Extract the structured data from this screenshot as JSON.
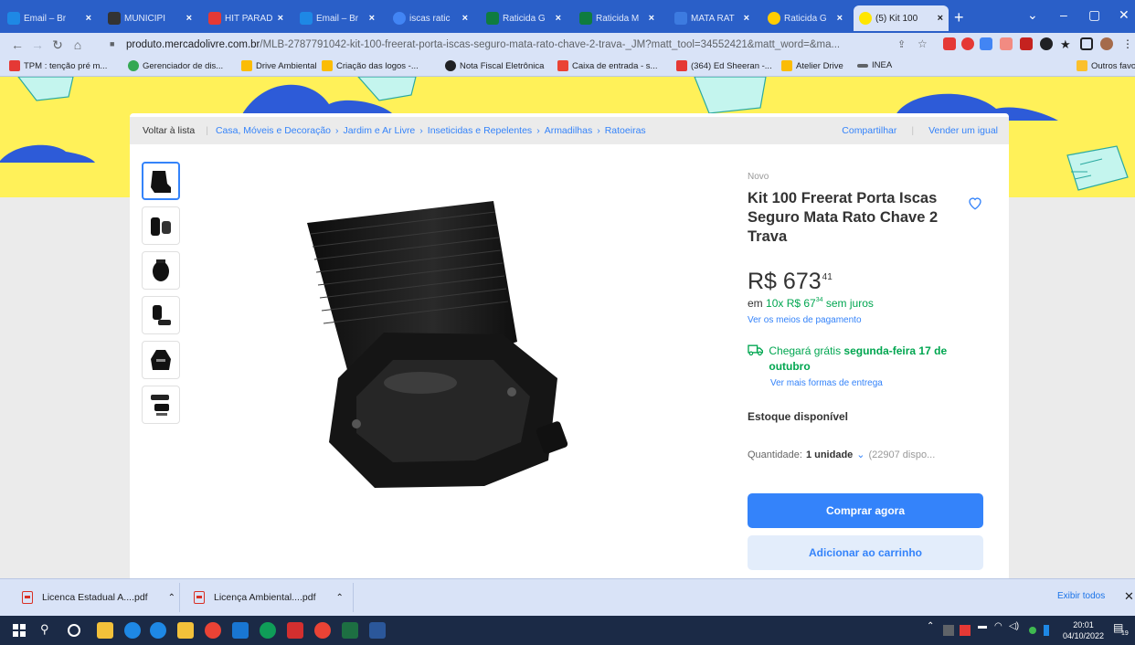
{
  "browser": {
    "tabs": [
      {
        "label": "Email – Br",
        "color": "#1e88e5"
      },
      {
        "label": "MUNICIPI",
        "color": "#333333"
      },
      {
        "label": "HIT PARAD",
        "color": "#e53935"
      },
      {
        "label": "Email – Br",
        "color": "#1e88e5"
      },
      {
        "label": "iscas ratic",
        "color": "#4285f4"
      },
      {
        "label": "Raticida G",
        "color": "#0f7c3f"
      },
      {
        "label": "Raticida M",
        "color": "#0f7c3f"
      },
      {
        "label": "MATA RAT",
        "color": "#3d7be0"
      },
      {
        "label": "Raticida G",
        "color": "#ffcc00"
      },
      {
        "label": "(5) Kit 100",
        "color": "#ffe600",
        "active": true
      }
    ],
    "url_host": "produto.mercadolivre.com.br",
    "url_path": "/MLB-2787791042-kit-100-freerat-porta-iscas-seguro-mata-rato-chave-2-trava-_JM?matt_tool=34552421&matt_word=&ma...",
    "bookmarks": [
      {
        "label": "TPM : tenção pré m...",
        "color": "#e53935"
      },
      {
        "label": "Gerenciador de dis...",
        "color": "#34a853"
      },
      {
        "label": "Drive Ambiental",
        "color": "#fbbc04"
      },
      {
        "label": "Criação das logos -...",
        "color": "#fbbc04"
      },
      {
        "label": "Nota Fiscal Eletrônica",
        "color": "#202124"
      },
      {
        "label": "Caixa de entrada - s...",
        "color": "#ea4335"
      },
      {
        "label": "(364) Ed Sheeran -...",
        "color": "#e53935"
      },
      {
        "label": "Atelier Drive",
        "color": "#fbbc04"
      },
      {
        "label": "INEA",
        "color": "#5f6368"
      }
    ],
    "other_bookmarks": "Outros favoritos"
  },
  "page": {
    "breadcrumb": {
      "back": "Voltar à lista",
      "items": [
        "Casa, Móveis e Decoração",
        "Jardim e Ar Livre",
        "Inseticidas e Repelentes",
        "Armadilhas",
        "Ratoeiras"
      ],
      "share": "Compartilhar",
      "sell": "Vender um igual"
    },
    "product": {
      "condition": "Novo",
      "title": "Kit 100 Freerat Porta Iscas Seguro Mata Rato Chave 2 Trava",
      "price_symbol": "R$",
      "price_int": "673",
      "price_cents": "41",
      "installments_prefix": "em ",
      "installments_count": "10x R$ 67",
      "installments_cents": "34",
      "installments_suffix": " sem juros",
      "payment_link": "Ver os meios de pagamento",
      "shipping_prefix": "Chegará grátis ",
      "shipping_date": "segunda-feira 17 de outubro",
      "shipping_more": "Ver mais formas de entrega",
      "stock": "Estoque disponível",
      "qty_label": "Quantidade: ",
      "qty_value": "1 unidade",
      "qty_available": "(22907 dispo...",
      "buy_now": "Comprar agora",
      "add_to_cart": "Adicionar ao carrinho"
    },
    "thumbnail_count": 6
  },
  "downloads": {
    "items": [
      "Licenca Estadual A....pdf",
      "Licença Ambiental....pdf"
    ],
    "show_all": "Exibir todos"
  },
  "taskbar": {
    "time": "20:01",
    "date": "04/10/2022",
    "notification_count": "19"
  },
  "colors": {
    "ml_yellow": "#fff159",
    "ml_blue": "#3483fa",
    "ml_green": "#00a650",
    "chrome_blue": "#2a5fc8"
  }
}
